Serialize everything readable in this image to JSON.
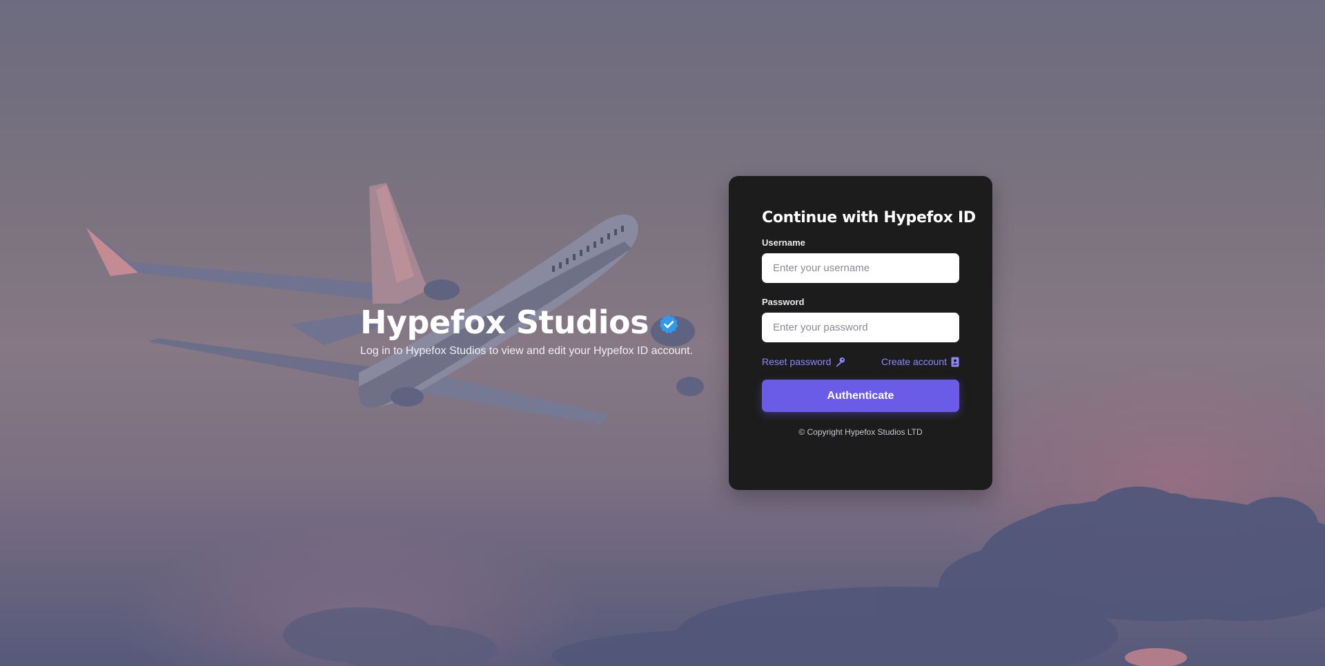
{
  "hero": {
    "title": "Hypefox Studios",
    "subtitle": "Log in to Hypefox Studios to view and edit your Hypefox ID account.",
    "badge_icon": "verified-badge-icon",
    "badge_color": "#2f9bf0"
  },
  "login_card": {
    "title": "Continue with Hypefox ID",
    "username": {
      "label": "Username",
      "placeholder": "Enter your username",
      "value": ""
    },
    "password": {
      "label": "Password",
      "placeholder": "Enter your password",
      "value": ""
    },
    "reset_password": {
      "label": "Reset password",
      "icon": "key-icon"
    },
    "create_account": {
      "label": "Create account",
      "icon": "contact-card-icon"
    },
    "submit_label": "Authenticate",
    "copyright": "© Copyright Hypefox Studios LTD"
  },
  "colors": {
    "card_background": "#1c1c1c",
    "accent": "#6b5ce7",
    "link": "#8f87ff"
  }
}
